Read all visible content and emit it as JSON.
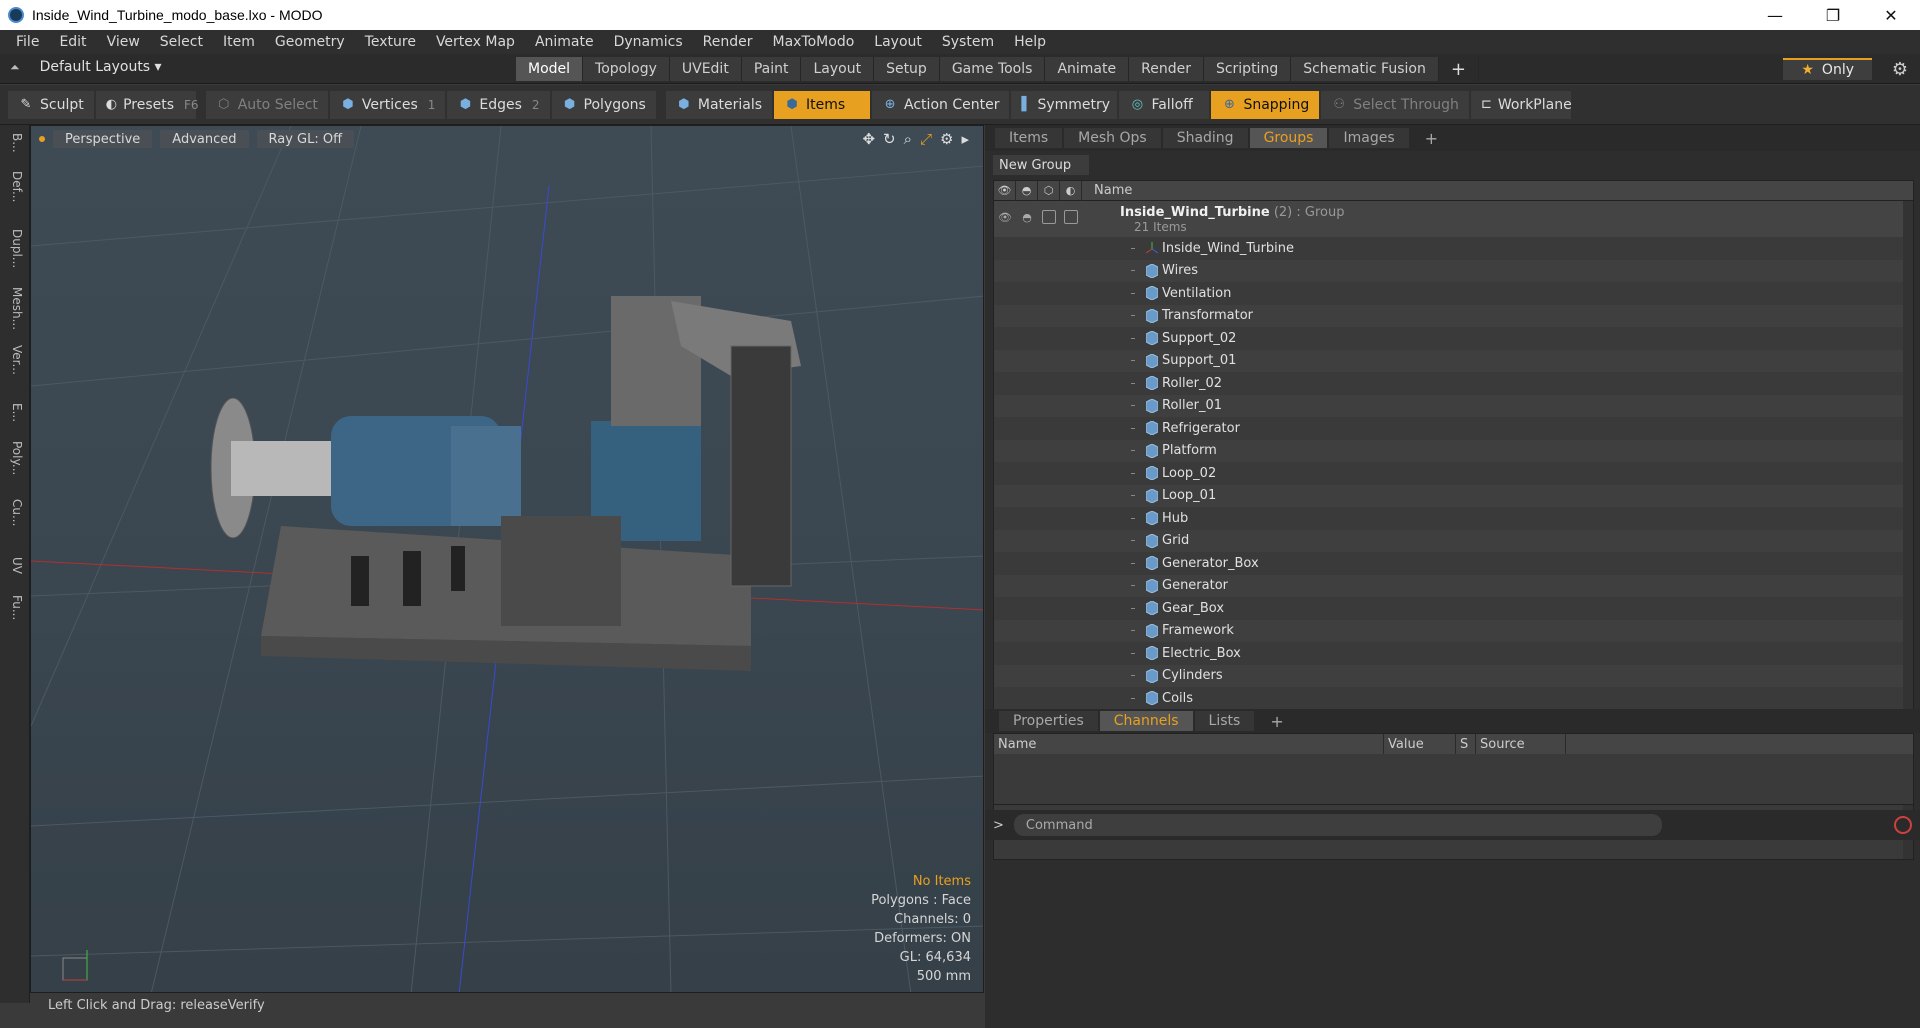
{
  "window": {
    "title": "Inside_Wind_Turbine_modo_base.lxo - MODO",
    "minimize": "—",
    "restore": "❐",
    "close": "✕"
  },
  "menu": [
    "File",
    "Edit",
    "View",
    "Select",
    "Item",
    "Geometry",
    "Texture",
    "Vertex Map",
    "Animate",
    "Dynamics",
    "Render",
    "MaxToModo",
    "Layout",
    "System",
    "Help"
  ],
  "layouts": {
    "label": "Default Layouts ▾"
  },
  "mode_tabs": [
    {
      "label": "Model",
      "active": true
    },
    {
      "label": "Topology"
    },
    {
      "label": "UVEdit"
    },
    {
      "label": "Paint"
    },
    {
      "label": "Layout"
    },
    {
      "label": "Setup"
    },
    {
      "label": "Game Tools"
    },
    {
      "label": "Animate"
    },
    {
      "label": "Render"
    },
    {
      "label": "Scripting"
    },
    {
      "label": "Schematic Fusion"
    }
  ],
  "mode_plus": "+",
  "only_label": "Only",
  "toolbar": {
    "sculpt": "Sculpt",
    "presets": "Presets",
    "presets_key": "F6",
    "auto_select": "Auto Select",
    "vertices": "Vertices",
    "vertices_num": "1",
    "edges": "Edges",
    "edges_num": "2",
    "polygons": "Polygons",
    "materials": "Materials",
    "items": "Items",
    "action_center": "Action Center",
    "symmetry": "Symmetry",
    "falloff": "Falloff",
    "snapping": "Snapping",
    "select_through": "Select Through",
    "workplane": "WorkPlane"
  },
  "left_strip": [
    "B...",
    "Def...",
    "Dupl...",
    "Mesh...",
    "Ver...",
    "E...",
    "Poly...",
    "Cu...",
    "UV",
    "Fu..."
  ],
  "viewport": {
    "perspective": "Perspective",
    "advanced": "Advanced",
    "raygl": "Ray GL: Off",
    "info": {
      "no_items": "No Items",
      "polygons": "Polygons : Face",
      "channels": "Channels: 0",
      "deformers": "Deformers: ON",
      "gl": "GL: 64,634",
      "scale": "500 mm"
    }
  },
  "status": {
    "text": "Left Click and Drag:   releaseVerify"
  },
  "right_tabs": [
    {
      "label": "Items"
    },
    {
      "label": "Mesh Ops"
    },
    {
      "label": "Shading"
    },
    {
      "label": "Groups",
      "active": true
    },
    {
      "label": "Images"
    }
  ],
  "right_plus": "+",
  "groups": {
    "new_group": "New Group",
    "name_header": "Name",
    "group_name": "Inside_Wind_Turbine",
    "group_meta": " (2) : Group",
    "group_count": "21 Items",
    "items": [
      {
        "label": "Inside_Wind_Turbine",
        "icon": "locator-icon"
      },
      {
        "label": "Wires"
      },
      {
        "label": "Ventilation"
      },
      {
        "label": "Transformator"
      },
      {
        "label": "Support_02"
      },
      {
        "label": "Support_01"
      },
      {
        "label": "Roller_02"
      },
      {
        "label": "Roller_01"
      },
      {
        "label": "Refrigerator"
      },
      {
        "label": "Platform"
      },
      {
        "label": "Loop_02"
      },
      {
        "label": "Loop_01"
      },
      {
        "label": "Hub"
      },
      {
        "label": "Grid"
      },
      {
        "label": "Generator_Box"
      },
      {
        "label": "Generator"
      },
      {
        "label": "Gear_Box"
      },
      {
        "label": "Framework"
      },
      {
        "label": "Electric_Box"
      },
      {
        "label": "Cylinders"
      },
      {
        "label": "Coils"
      }
    ]
  },
  "props_tabs": [
    {
      "label": "Properties"
    },
    {
      "label": "Channels",
      "active": true
    },
    {
      "label": "Lists"
    }
  ],
  "props_plus": "+",
  "channels": {
    "name": "Name",
    "value": "Value",
    "s": "S",
    "source": "Source"
  },
  "command": {
    "prompt": ">",
    "placeholder": "Command"
  }
}
